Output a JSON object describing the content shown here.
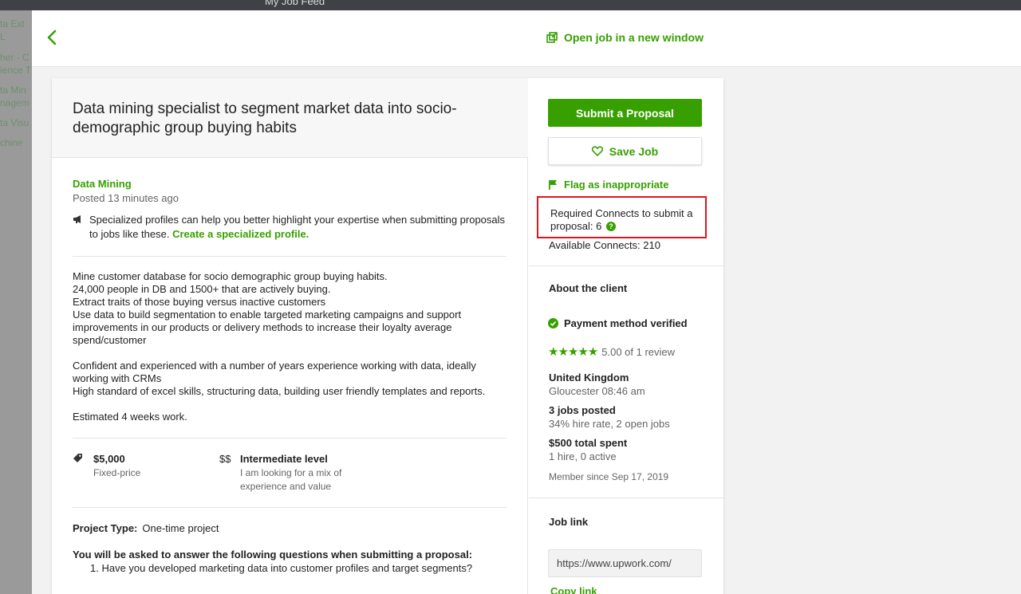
{
  "topbar": {
    "title": "My Job Feed"
  },
  "background_list": [
    "ta Ext",
    "L",
    "her - C",
    "ience T",
    "ta Min",
    "nagem",
    "ta Visu",
    "chine"
  ],
  "header": {
    "open_window_label": "Open job in a new window"
  },
  "job": {
    "title": "Data mining specialist to segment market data into socio-demographic group buying habits",
    "category": "Data Mining",
    "posted": "Posted 13 minutes ago",
    "specialized_text": "Specialized profiles can help you better highlight your expertise when submitting proposals to jobs like these. ",
    "specialized_link": "Create a specialized profile.",
    "description": [
      "Mine customer database for socio demographic group buying habits.",
      "24,000 people in DB and 1500+ that are actively buying.",
      "Extract traits of those buying versus inactive customers",
      "Use data to build segmentation to enable targeted marketing campaigns and support improvements in our products or delivery methods to increase their loyalty average spend/customer",
      "",
      "Confident and experienced with a number of years experience working with data, ideally working with CRMs",
      "High standard of excel skills, structuring data, building user friendly templates and reports.",
      "",
      "Estimated 4 weeks work."
    ],
    "budget": {
      "icon": "tag-icon",
      "amount": "$5,000",
      "type": "Fixed-price"
    },
    "level": {
      "icon": "$$",
      "title": "Intermediate level",
      "desc": "I am looking for a mix of experience and value"
    },
    "project_type_label": "Project Type:",
    "project_type_value": "One-time project",
    "questions_title": "You will be asked to answer the following questions when submitting a proposal:",
    "questions": [
      "1. Have you developed marketing data into customer profiles and target segments?"
    ]
  },
  "actions": {
    "submit_label": "Submit a Proposal",
    "save_label": "Save Job",
    "flag_label": "Flag as inappropriate",
    "connects_required": "Required Connects to submit a proposal: 6",
    "connects_available": "Available Connects: 210"
  },
  "client": {
    "about_title": "About the client",
    "payment_verified": "Payment method verified",
    "stars": "★★★★★",
    "rating_text": "5.00 of 1 review",
    "country": "United Kingdom",
    "location_time": "Gloucester 08:46 am",
    "jobs_posted": "3 jobs posted",
    "hire_rate": "34% hire rate, 2 open jobs",
    "total_spent": "$500 total spent",
    "hires": "1 hire, 0 active",
    "member_since": "Member since Sep 17, 2019"
  },
  "job_link": {
    "title": "Job link",
    "url": "https://www.upwork.com/",
    "copy_label": "Copy link"
  },
  "colors": {
    "brand_green": "#37a000",
    "highlight_red": "#e0141e"
  }
}
